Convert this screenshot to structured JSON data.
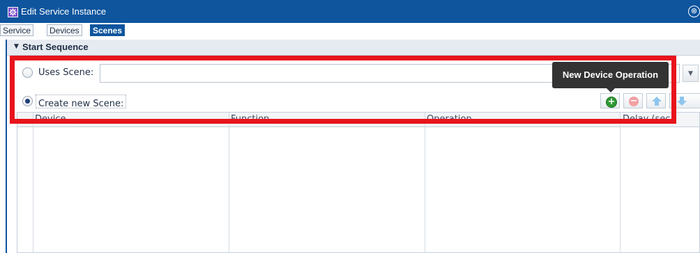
{
  "window": {
    "title": "Edit Service Instance",
    "close_glyph": "⊗"
  },
  "tabs": [
    {
      "label": "Service",
      "active": false
    },
    {
      "label": "Devices",
      "active": false
    },
    {
      "label": "Scenes",
      "active": true
    }
  ],
  "section": {
    "title": "Start Sequence",
    "arrow_glyph": "▼"
  },
  "scene_options": {
    "uses_scene_label": "Uses Scene:",
    "uses_scene_selected": false,
    "uses_scene_value": "",
    "dropdown_glyph": "▼",
    "create_new_label": "Create new Scene:",
    "create_new_selected": true
  },
  "toolbar": {
    "add_icon": "plus-circle-icon",
    "remove_icon": "minus-circle-icon",
    "up_icon": "arrow-up-icon",
    "down_icon": "arrow-down-icon"
  },
  "tooltip": {
    "text": "New Device Operation"
  },
  "table": {
    "columns": [
      "Device",
      "Function",
      "Operation",
      "Delay (sec"
    ],
    "rows": []
  },
  "colors": {
    "titlebar": "#0e559e",
    "highlight": "#e8141c",
    "add_green": "#2f9a32",
    "remove_red": "#f2a0a4",
    "arrow_blue": "#8ec5ee"
  }
}
